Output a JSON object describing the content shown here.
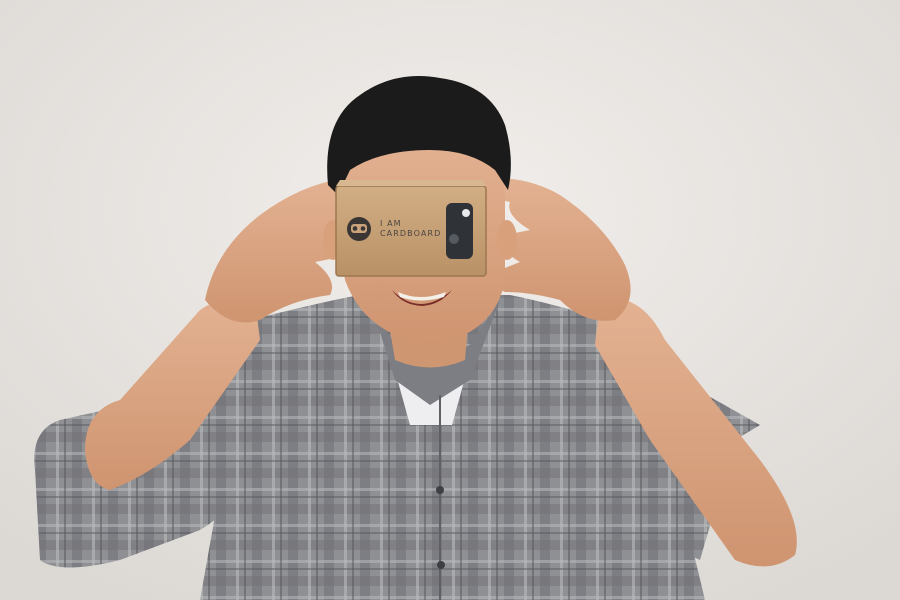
{
  "photo": {
    "wall_color": "#e9e6e2",
    "shirt_color": "#8c8d91",
    "skin_color": "#d9a381",
    "cardboard_color": "#c9a47a"
  },
  "viewer": {
    "logo_icon": "cardboard-logo-icon",
    "label_line1": "I AM",
    "label_line2": "CARDBOARD"
  }
}
